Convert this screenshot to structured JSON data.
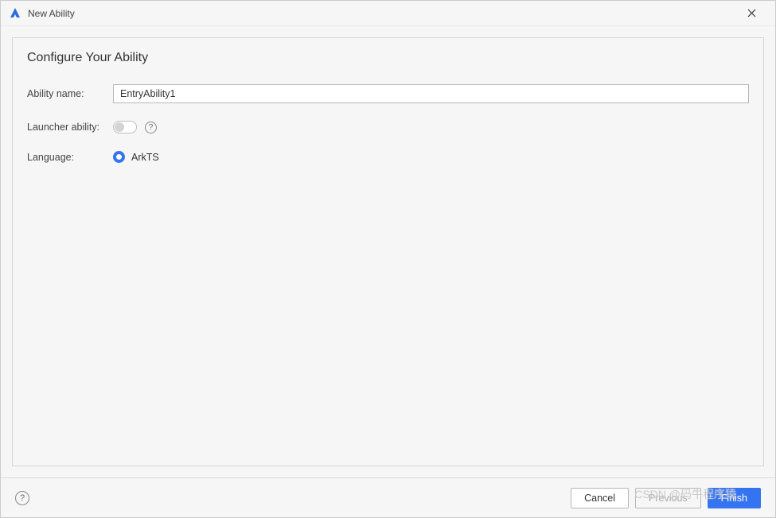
{
  "window": {
    "title": "New Ability"
  },
  "section": {
    "title": "Configure Your Ability"
  },
  "form": {
    "ability_name": {
      "label": "Ability name:",
      "value": "EntryAbility1"
    },
    "launcher_ability": {
      "label": "Launcher ability:",
      "checked": false
    },
    "language": {
      "label": "Language:",
      "option": "ArkTS",
      "selected": true
    }
  },
  "footer": {
    "cancel": "Cancel",
    "previous": "Previous",
    "finish": "Finish"
  },
  "watermark": "CSDN @码牛程序猿"
}
